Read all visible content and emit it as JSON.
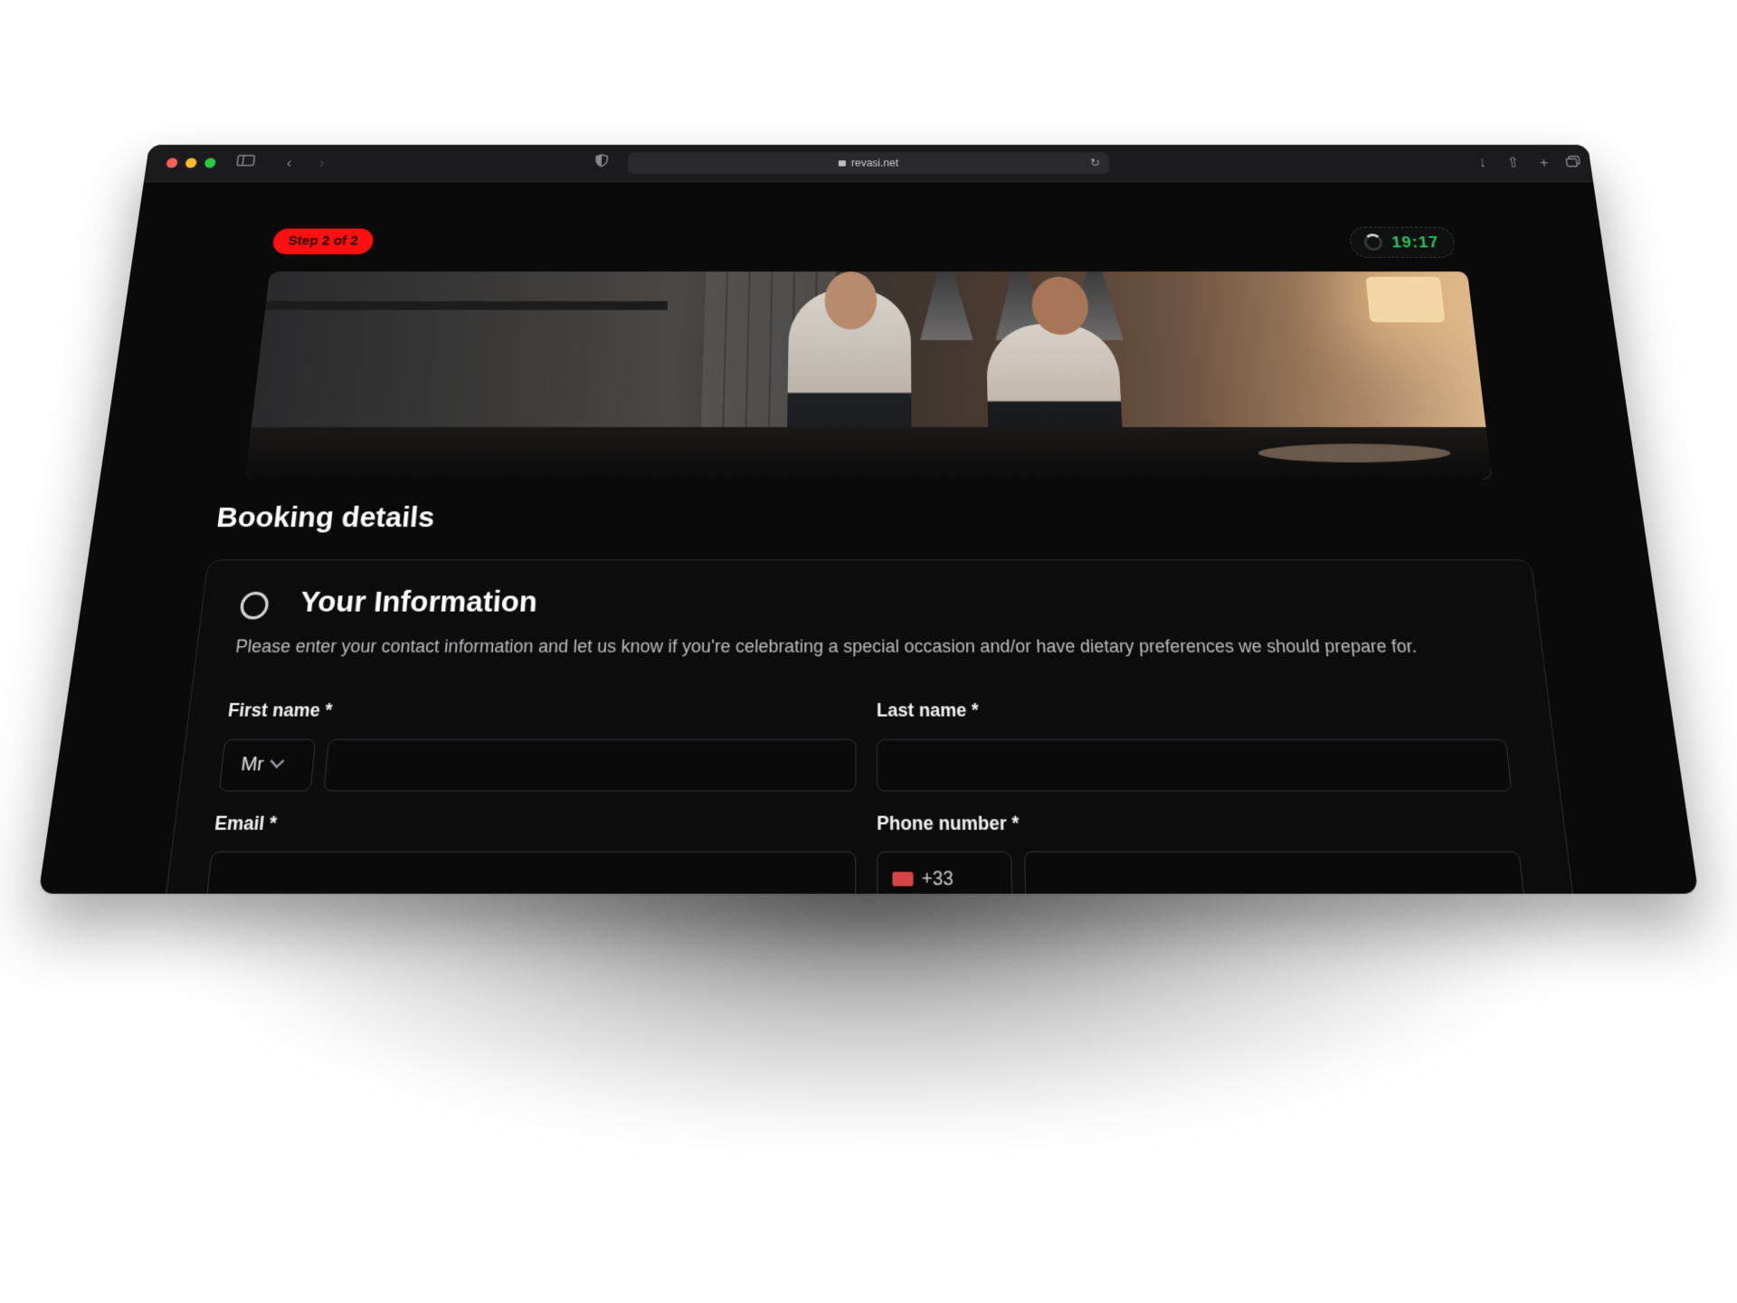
{
  "browser": {
    "url": "revasi.net",
    "traffic_lights": [
      "#ff5f57",
      "#febc2e",
      "#28c840"
    ]
  },
  "booking": {
    "step_label": "Step 2 of 2",
    "timer": "19:17",
    "title": "Booking details"
  },
  "your_information": {
    "title": "Your Information",
    "description": "Please enter your contact information and let us know if you're celebrating a special occasion and/or have dietary preferences we should prepare for.",
    "first_name_label": "First name *",
    "salutation_value": "Mr",
    "last_name_label": "Last name *",
    "email_label": "Email *",
    "phone_label": "Phone number *",
    "phone_code": "+33"
  },
  "colors": {
    "accent_red": "#ff1010",
    "timer_green": "#22c55e",
    "page_bg": "#0a0a0b"
  }
}
